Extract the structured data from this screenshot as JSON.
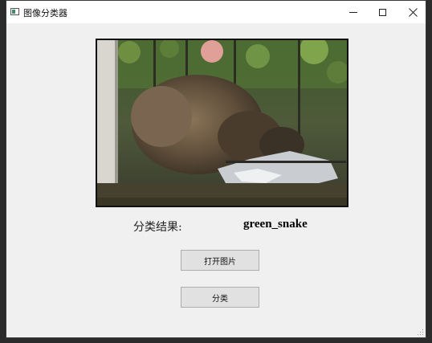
{
  "window": {
    "title": "图像分类器",
    "controls": {
      "minimize": "minimize-icon",
      "maximize": "maximize-icon",
      "close": "close-icon"
    }
  },
  "preview": {
    "icon": "image-preview"
  },
  "result": {
    "label": "分类结果:",
    "value": "green_snake"
  },
  "buttons": {
    "open_image": "打开图片",
    "classify": "分类"
  }
}
